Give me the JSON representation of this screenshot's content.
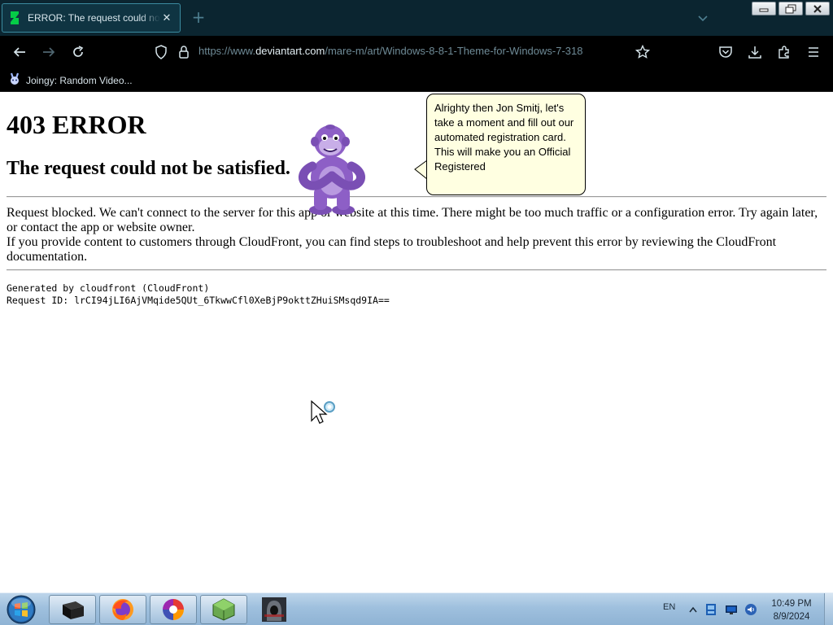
{
  "colors": {
    "tabbar_bg": "#0b2530",
    "navbar_bg": "#000000",
    "balloon_bg": "#ffffe1",
    "buddy_purple": "#8d5fc6",
    "taskbar_top": "#bdd5ea",
    "favicon_green": "#05cc47"
  },
  "tab": {
    "title": "ERROR: The request could not be satisfied",
    "favicon": "deviantart-icon",
    "close_glyph": "✕"
  },
  "toolbar": {
    "new_tab_glyph": "+",
    "url_prefix": "https://www.",
    "url_domain": "deviantart.com",
    "url_path": "/mare-m/art/Windows-8-8-1-Theme-for-Windows-7-318",
    "icons": [
      "back-icon",
      "forward-icon",
      "reload-icon",
      "shield-icon",
      "lock-icon",
      "bookmark-star-icon",
      "pocket-icon",
      "download-icon",
      "extensions-icon",
      "menu-icon"
    ]
  },
  "bookmarks": [
    {
      "label": "Joingy: Random Video...",
      "icon": "rabbit-icon"
    }
  ],
  "page": {
    "heading": "403 ERROR",
    "subheading": "The request could not be satisfied.",
    "para1": "Request blocked. We can't connect to the server for this app or website at this time. There might be too much traffic or a configuration error. Try again later, or contact the app or website owner.",
    "para2": "If you provide content to customers through CloudFront, you can find steps to troubleshoot and help prevent this error by reviewing the CloudFront documentation.",
    "generated_by": "Generated by cloudfront (CloudFront)",
    "request_id": "Request ID: lrCI94jLI6AjVMqide5QUt_6TkwwCfl0XeBjP9okttZHuiSMsqd9IA=="
  },
  "assistant": {
    "character": "purple-gorilla-assistant",
    "balloon_text": "Alrighty then Jon Smitj, let's take a moment and fill out our automated registration card. This will make you an Official Registered"
  },
  "taskbar": {
    "start": "windows-start-orb",
    "apps": [
      "black-box-app-icon",
      "firefox-icon",
      "swirl-browser-icon",
      "green-cube-app-icon",
      "hooded-figure-app-icon"
    ],
    "language": "EN",
    "tray_icons": [
      "show-hidden-icons-arrow",
      "network-flag-icon",
      "monitor-icon",
      "volume-icon"
    ],
    "time": "10:49 PM",
    "date": "8/9/2024"
  }
}
